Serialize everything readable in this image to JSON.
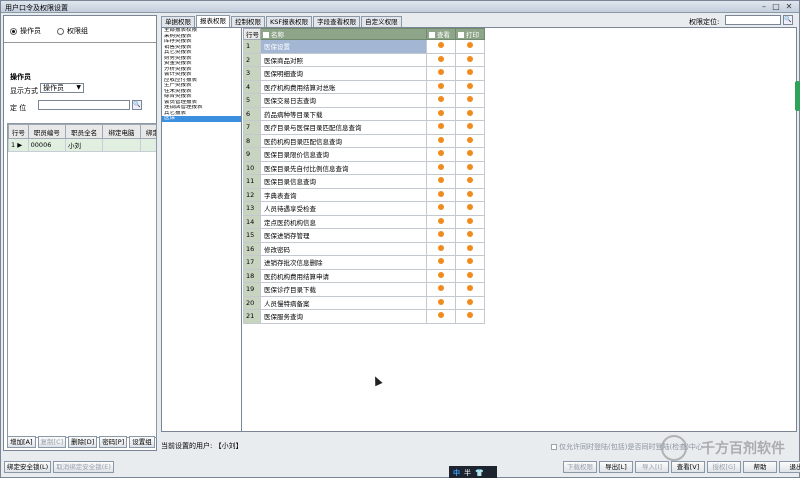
{
  "window": {
    "title": "用户口令及权限设置"
  },
  "mode": {
    "options": [
      "操作员",
      "权限组"
    ],
    "selected": 0
  },
  "operator_section": {
    "title": "操作员",
    "display_mode_label": "显示方式",
    "display_mode_value": "操作员",
    "locate_label": "定    位"
  },
  "employee_grid": {
    "columns": [
      "行号",
      "职员编号",
      "职员全名",
      "绑定电脑",
      "绑定安全"
    ],
    "rows": [
      {
        "row": "1",
        "code": "00006",
        "name": "小刘",
        "pc": "",
        "sec": ""
      }
    ]
  },
  "left_buttons": [
    {
      "label": "增加[A]",
      "enabled": true
    },
    {
      "label": "复制[C]",
      "enabled": false
    },
    {
      "label": "删除[D]",
      "enabled": true
    },
    {
      "label": "密码[P]",
      "enabled": true
    },
    {
      "label": "设置组",
      "enabled": true
    }
  ],
  "bottom_left_buttons": [
    {
      "label": "绑定安全锁(L)",
      "enabled": true
    },
    {
      "label": "取消绑定安全锁(E)",
      "enabled": false
    }
  ],
  "tabs": [
    "单据权限",
    "报表权限",
    "控制权限",
    "KSF报表权限",
    "字段查看权限",
    "自定义权限"
  ],
  "active_tab": 1,
  "permission_locate_label": "权限定位:",
  "categories": [
    "全部报表权限",
    "采购类报表",
    "库存类报表",
    "销售类报表",
    "其它类报表",
    "财务类报表",
    "资金类报表",
    "分析类报表",
    "会计类报表",
    "应收应付报表",
    "生产类报表",
    "往来类报表",
    "综合类报表",
    "会员管理报表",
    "连锁店管理报表",
    "其它报表",
    "医保"
  ],
  "active_category": 16,
  "perm_grid": {
    "columns": [
      "行号",
      "名称",
      "查看",
      "打印"
    ],
    "rows": [
      "医保设置",
      "医保商品对照",
      "医保明细查询",
      "医疗机构费用结算对总账",
      "医保交易日志查询",
      "药品病种等目录下载",
      "医疗目录与医保目录匹配信息查询",
      "医药机构目录匹配信息查询",
      "医保目录限价信息查询",
      "医保目录先自付比例信息查询",
      "医保目录信息查询",
      "字典表查询",
      "人员待遇享受检查",
      "定点医药机构信息",
      "医保进销存管理",
      "修改密码",
      "进销存批次信息删除",
      "医药机构费用结算申请",
      "医保诊疗目录下载",
      "人员慢特病备案",
      "医保服务查询"
    ],
    "highlight_row": 0
  },
  "current_user_text": "当前设置的用户: 【小刘】",
  "option_checkbox_label": "仅允许同时登陆(包括)是否同时登陆(检查)中心",
  "right_buttons": [
    {
      "label": "下载权限",
      "enabled": false
    },
    {
      "label": "导出[L]",
      "enabled": true
    },
    {
      "label": "导入[I]",
      "enabled": false
    },
    {
      "label": "查看[V]",
      "enabled": true
    },
    {
      "label": "授权[G]",
      "enabled": false
    },
    {
      "label": "帮助",
      "enabled": true
    },
    {
      "label": "退出",
      "enabled": true
    }
  ],
  "ime": {
    "lang": "中",
    "mode": "半"
  },
  "watermark": "千方百剂软件"
}
